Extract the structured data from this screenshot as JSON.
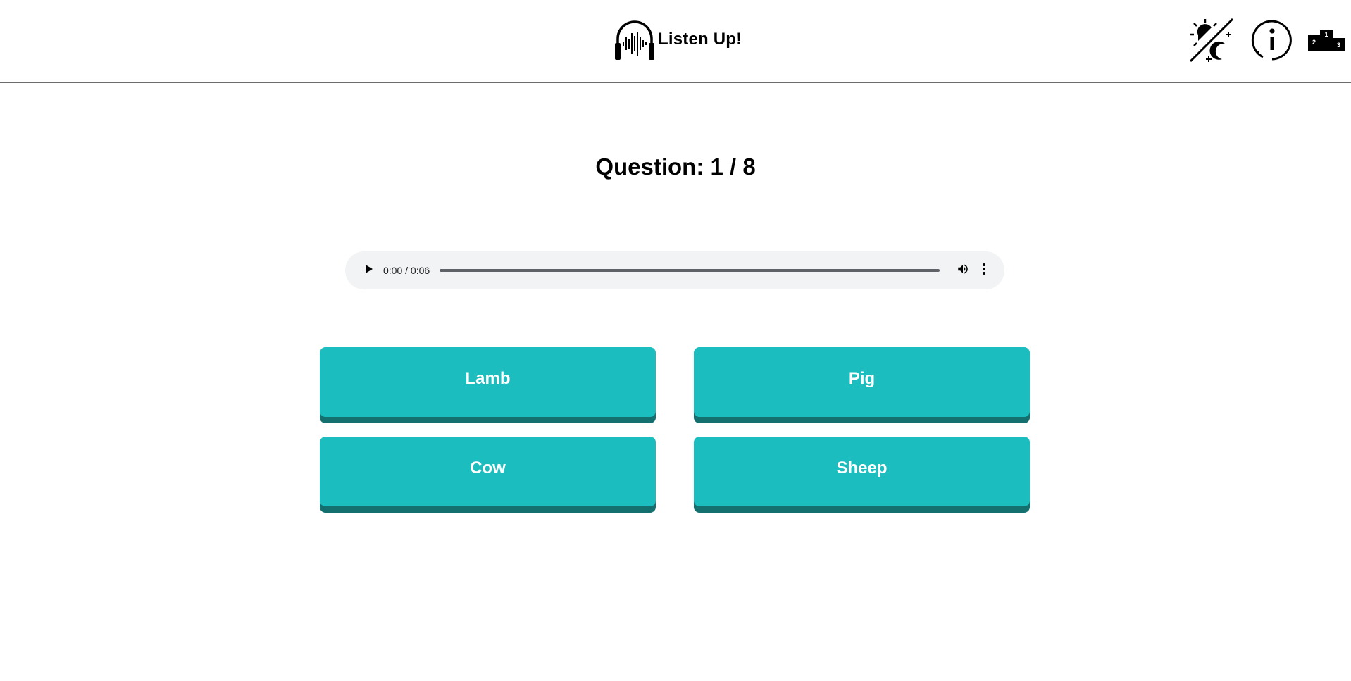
{
  "header": {
    "title": "Listen Up!",
    "logo_icon": "headphones-waveform-icon",
    "actions": [
      {
        "name": "theme-toggle",
        "icon": "sun-moon-icon"
      },
      {
        "name": "info",
        "icon": "info-icon"
      },
      {
        "name": "leaderboard",
        "icon": "podium-icon",
        "podium_labels": [
          "2",
          "1",
          "3"
        ]
      }
    ]
  },
  "quiz": {
    "question_label": "Question: 1 / 8",
    "audio": {
      "time_display": "0:00 / 0:06",
      "progress": 0,
      "play_icon": "play-icon",
      "volume_icon": "volume-icon",
      "more_icon": "more-vert-icon"
    },
    "answers": [
      {
        "label": "Lamb"
      },
      {
        "label": "Pig"
      },
      {
        "label": "Cow"
      },
      {
        "label": "Sheep"
      }
    ]
  },
  "colors": {
    "answer_button": "#1bbdbe",
    "answer_button_shadow": "#14706f",
    "audio_bg": "#f1f3f4"
  }
}
